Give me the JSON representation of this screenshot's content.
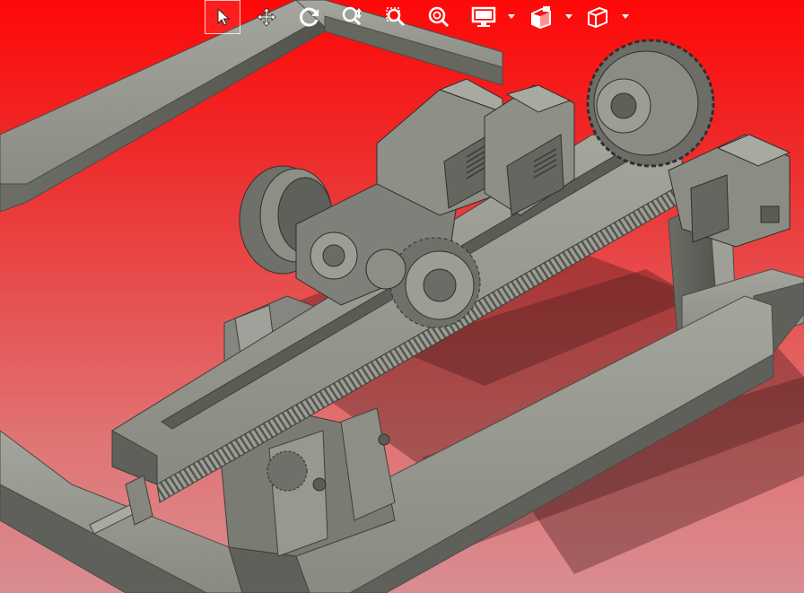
{
  "app": {
    "background_top_color": "#ff0808",
    "background_bottom_color": "#d98c92",
    "model_color": "#8a8b83"
  },
  "toolbar": {
    "buttons": [
      {
        "name": "select-tool-button",
        "icon": "arrow-pointer-icon",
        "active": true
      },
      {
        "name": "pan-tool-button",
        "icon": "move-arrows-icon",
        "active": false
      },
      {
        "name": "rotate-tool-button",
        "icon": "rotate-icon",
        "active": false
      },
      {
        "name": "zoom-tool-button",
        "icon": "zoom-in-out-icon",
        "active": false
      },
      {
        "name": "zoom-window-button",
        "icon": "zoom-window-icon",
        "active": false
      },
      {
        "name": "zoom-fit-button",
        "icon": "zoom-fit-icon",
        "active": false
      },
      {
        "name": "display-style-button",
        "icon": "monitor-icon",
        "active": false,
        "has_dropdown": true
      },
      {
        "name": "view-orientation-button",
        "icon": "views-icon",
        "active": false,
        "has_dropdown": true
      },
      {
        "name": "standard-view-button",
        "icon": "cube-icon",
        "active": false,
        "has_dropdown": true
      }
    ]
  },
  "model": {
    "description_parts": [
      "frame",
      "gear-rack",
      "motor-left",
      "motor-right",
      "motor-front",
      "large-gear",
      "pinion-gear",
      "pulley-wheel",
      "base-block",
      "axle-pin"
    ]
  }
}
